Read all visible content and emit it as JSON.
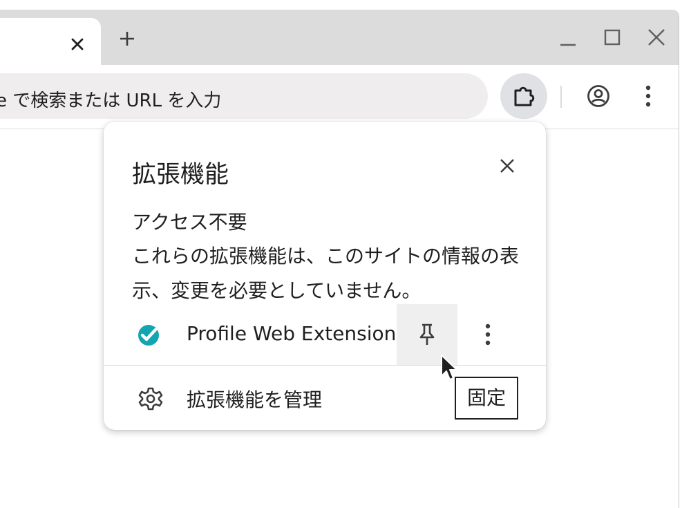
{
  "browser": {
    "tab_close_icon": "close-icon",
    "new_tab_icon": "plus-icon",
    "window_controls": [
      "minimize-icon",
      "maximize-icon",
      "close-icon"
    ]
  },
  "toolbar": {
    "omnibox_text": "e で検索または URL を入力",
    "extensions_icon": "puzzle-icon",
    "profile_icon": "account-circle-icon",
    "menu_icon": "more-vert-icon"
  },
  "popup": {
    "title": "拡張機能",
    "close_icon": "close-icon",
    "section_heading": "アクセス不要",
    "section_description": "これらの拡張機能は、このサイトの情報の表示、変更を必要としていません。",
    "extensions": [
      {
        "name": "Profile Web Extension",
        "icon": "check-badge-icon",
        "icon_color": "#12a6b0",
        "pin_icon": "pin-icon",
        "more_icon": "more-vert-icon"
      }
    ],
    "manage_label": "拡張機能を管理",
    "manage_icon": "gear-icon"
  },
  "tooltip": {
    "text": "固定"
  },
  "colors": {
    "tabstrip": "#dcdcdc",
    "omnibox": "#efeded",
    "extensions_button_active": "#dfe1e5",
    "pin_hover": "#efefef",
    "text": "#1f1f1f"
  }
}
